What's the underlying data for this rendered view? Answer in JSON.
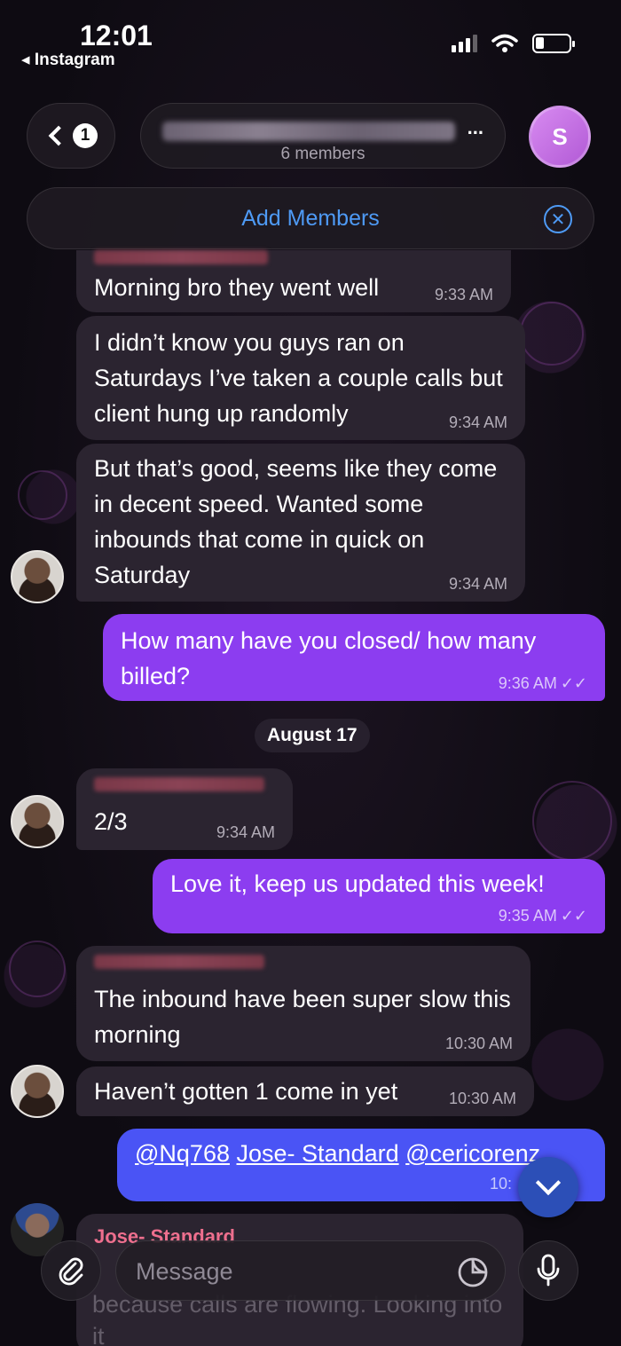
{
  "status_bar": {
    "time": "12:01",
    "back_app": "◂ Instagram",
    "battery_level": 0.25
  },
  "header": {
    "unread_count": "1",
    "title_ellipsis": "...",
    "members": "6 members",
    "avatar_letter": "S"
  },
  "add_members": {
    "label": "Add Members",
    "close_glyph": "✕"
  },
  "messages": [
    {
      "text": "Morning bro they went well",
      "time": "9:33 AM"
    },
    {
      "text": "I didn’t know you guys ran on Saturdays I’ve taken a couple calls but client hung up randomly",
      "time": "9:34 AM"
    },
    {
      "text": "But that’s good, seems like they come in decent speed. Wanted some inbounds that come in quick on Saturday",
      "time": "9:34 AM"
    },
    {
      "text": "How many have you closed/ how many billed?",
      "time": "9:36 AM"
    },
    {
      "text": "2/3",
      "time": "9:34 AM"
    },
    {
      "text": "Love it, keep us updated this week!",
      "time": "9:35 AM"
    },
    {
      "text": "The inbound have been super slow this morning",
      "time": "10:30 AM"
    },
    {
      "text": "Haven’t gotten 1 come in yet",
      "time": "10:30 AM"
    },
    {
      "mention1": "@Nq768",
      "mention2": "Jose- Standard",
      "mention3": "@cericorenz",
      "time": "10:"
    },
    {
      "sender": "Jose- Standard",
      "text": "because calls are flowing. Looking into it"
    }
  ],
  "date_separator": "August 17",
  "read_checks": "✓✓",
  "input": {
    "placeholder": "Message"
  }
}
